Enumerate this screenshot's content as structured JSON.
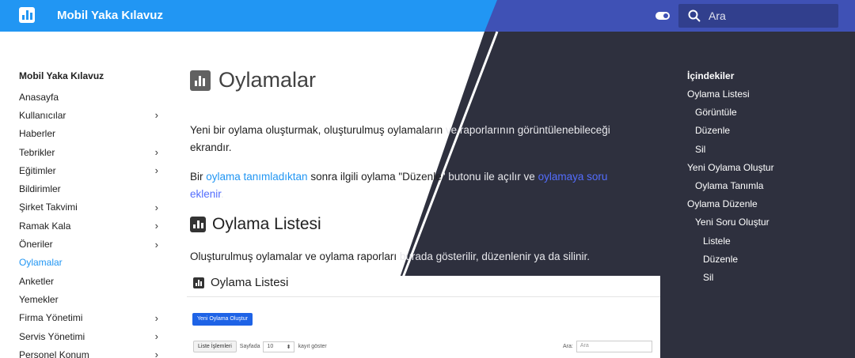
{
  "header": {
    "site_title": "Mobil Yaka Kılavuz",
    "search_placeholder": "Ara"
  },
  "nav": {
    "title": "Mobil Yaka Kılavuz",
    "items": [
      {
        "label": "Anasayfa",
        "expandable": false
      },
      {
        "label": "Kullanıcılar",
        "expandable": true
      },
      {
        "label": "Haberler",
        "expandable": false
      },
      {
        "label": "Tebrikler",
        "expandable": true
      },
      {
        "label": "Eğitimler",
        "expandable": true
      },
      {
        "label": "Bildirimler",
        "expandable": false
      },
      {
        "label": "Şirket Takvimi",
        "expandable": true
      },
      {
        "label": "Ramak Kala",
        "expandable": true
      },
      {
        "label": "Öneriler",
        "expandable": true
      },
      {
        "label": "Oylamalar",
        "expandable": false,
        "active": true
      },
      {
        "label": "Anketler",
        "expandable": false
      },
      {
        "label": "Yemekler",
        "expandable": false
      },
      {
        "label": "Firma Yönetimi",
        "expandable": true
      },
      {
        "label": "Servis Yönetimi",
        "expandable": true
      },
      {
        "label": "Personel Konum",
        "expandable": true
      }
    ]
  },
  "main": {
    "title": "Oylamalar",
    "intro_a": "Yeni bir oylama oluşturmak, oluşturulmuş oylamaların ",
    "intro_b": "ve raporlarının görüntülenebileceği",
    "intro_c": "ekrandır.",
    "p2_a": "Bir ",
    "p2_link1": "oylama tanımladıktan",
    "p2_b": " sonra ilgili oylama \"Düzenle",
    "p2_c": "\" butonu ile açılır ve ",
    "p2_link2": "oylamaya soru eklenir",
    "p2_d": ".",
    "section_title": "Oylama Listesi",
    "p3_a": "Oluşturulmuş oylamalar ve oylama raporları ",
    "p3_b": "burada gösterilir, düzenlenir ya da silinir."
  },
  "screenshot": {
    "title": "Oylama Listesi",
    "new_button": "Yeni Oylama Oluştur",
    "list_ops": "Liste İşlemleri",
    "page_label": "Sayfada",
    "page_size": "10",
    "records_label": "kayıt göster",
    "search_label": "Ara:",
    "search_placeholder": "Ara"
  },
  "toc": {
    "title": "İçindekiler",
    "items": [
      {
        "label": "Oylama Listesi",
        "level": 1
      },
      {
        "label": "Görüntüle",
        "level": 2
      },
      {
        "label": "Düzenle",
        "level": 2
      },
      {
        "label": "Sil",
        "level": 2
      },
      {
        "label": "Yeni Oylama Oluştur",
        "level": 1
      },
      {
        "label": "Oylama Tanımla",
        "level": 2
      },
      {
        "label": "Oylama Düzenle",
        "level": 1
      },
      {
        "label": "Yeni Soru Oluştur",
        "level": 2
      },
      {
        "label": "Listele",
        "level": 3
      },
      {
        "label": "Düzenle",
        "level": 3
      },
      {
        "label": "Sil",
        "level": 3
      }
    ]
  },
  "colors": {
    "primary": "#2196f3",
    "primary_dark_mode": "#3f51b5",
    "dark_background": "#2e303e",
    "screenshot_button": "#1e63e6"
  }
}
